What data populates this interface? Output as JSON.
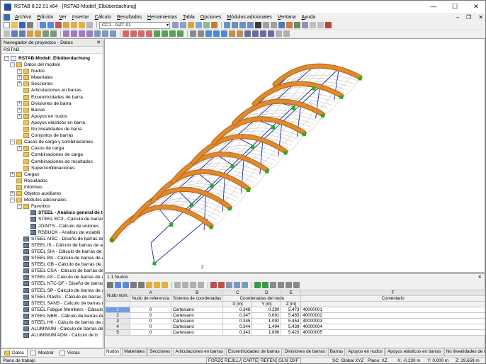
{
  "window": {
    "title": "RSTAB 8.22.01 x64 - [RSTAB-Modell_Elbüberdachung]",
    "minimize": "—",
    "maximize": "☐",
    "close": "✕"
  },
  "menu": {
    "items": [
      "Archivo",
      "Edición",
      "Ver",
      "Insertar",
      "Cálculo",
      "Resultados",
      "Herramientas",
      "Tabla",
      "Opciones",
      "Módulos adicionales",
      "Ventana",
      "Ayuda"
    ]
  },
  "toolbar": {
    "load_case_combo": "CC1 - GZT 01"
  },
  "navigator": {
    "title": "Navegador de proyectos - Datos",
    "root": "RSTAB",
    "model": "RSTAB-Modell_Elbüberdachung",
    "items": [
      {
        "label": "Datos del modelo",
        "level": 1,
        "icon": "folder"
      },
      {
        "label": "Nudos",
        "level": 2,
        "icon": "folder"
      },
      {
        "label": "Materiales",
        "level": 2,
        "icon": "folder"
      },
      {
        "label": "Secciones",
        "level": 2,
        "icon": "folder"
      },
      {
        "label": "Articulaciones en barras",
        "level": 2,
        "icon": "folder"
      },
      {
        "label": "Excentricidades de barra",
        "level": 2,
        "icon": "folder"
      },
      {
        "label": "Divisiones de barra",
        "level": 2,
        "icon": "folder"
      },
      {
        "label": "Barras",
        "level": 2,
        "icon": "folder"
      },
      {
        "label": "Apoyos en nudos",
        "level": 2,
        "icon": "folder"
      },
      {
        "label": "Apoyos elásticos en barra",
        "level": 2,
        "icon": "folder"
      },
      {
        "label": "No linealidades de barra",
        "level": 2,
        "icon": "folder"
      },
      {
        "label": "Conjuntos de barras",
        "level": 2,
        "icon": "folder"
      },
      {
        "label": "Casos de carga y combinaciones",
        "level": 1,
        "icon": "folder"
      },
      {
        "label": "Casos de carga",
        "level": 2,
        "icon": "folder"
      },
      {
        "label": "Combinaciones de carga",
        "level": 2,
        "icon": "folder"
      },
      {
        "label": "Combinaciones de resultados",
        "level": 2,
        "icon": "folder"
      },
      {
        "label": "Supercombinaciones",
        "level": 2,
        "icon": "folder"
      },
      {
        "label": "Cargas",
        "level": 1,
        "icon": "folder"
      },
      {
        "label": "Resultados",
        "level": 1,
        "icon": "folder"
      },
      {
        "label": "Informes",
        "level": 1,
        "icon": "folder"
      },
      {
        "label": "Objetos auxiliares",
        "level": 1,
        "icon": "folder"
      },
      {
        "label": "Módulos adicionales",
        "level": 1,
        "icon": "folder"
      },
      {
        "label": "Favoritos",
        "level": 2,
        "icon": "folder"
      },
      {
        "label": "STEEL - Análisis general de t",
        "level": 3,
        "icon": "steel",
        "bold": true
      },
      {
        "label": "STEEL EC3 - Cálculo de barras",
        "level": 3,
        "icon": "steel"
      },
      {
        "label": "JOINTS - Cálculo de uniones",
        "level": 3,
        "icon": "steel"
      },
      {
        "label": "RSBUCK - Análisis de estabili",
        "level": 3,
        "icon": "steel"
      },
      {
        "label": "STEEL AISC - Diseño de barras de",
        "level": 2,
        "icon": "steel"
      },
      {
        "label": "STEEL IS - Cálculo de barras de ac",
        "level": 2,
        "icon": "steel"
      },
      {
        "label": "STEEL SIA - Cálculo de barras de a",
        "level": 2,
        "icon": "steel"
      },
      {
        "label": "STEEL BS - Cálculo de barras de a",
        "level": 2,
        "icon": "steel"
      },
      {
        "label": "STEEL GB - Cálculo de barras de a",
        "level": 2,
        "icon": "steel"
      },
      {
        "label": "STEEL CSA - Cálculo de barras de",
        "level": 2,
        "icon": "steel"
      },
      {
        "label": "STEEL AS - Cálculo de barras de a",
        "level": 2,
        "icon": "steel"
      },
      {
        "label": "STEEL NTC-DF - Diseño de barras",
        "level": 2,
        "icon": "steel"
      },
      {
        "label": "STEEL SP - Cálculo de barras de a",
        "level": 2,
        "icon": "steel"
      },
      {
        "label": "STEEL Plastic - Cálculo de barras",
        "level": 2,
        "icon": "steel"
      },
      {
        "label": "STEEL SANS - Cálculo de barras d",
        "level": 2,
        "icon": "steel"
      },
      {
        "label": "STEEL Fatigue Members - Cálculo",
        "level": 2,
        "icon": "steel"
      },
      {
        "label": "STEEL NBR - Cálculo de barras de",
        "level": 2,
        "icon": "steel"
      },
      {
        "label": "STEEL HK - Cálculo de barras de a",
        "level": 2,
        "icon": "steel"
      },
      {
        "label": "ALUMINUM - Cálculo de barras de",
        "level": 2,
        "icon": "steel"
      },
      {
        "label": "ALUMINUM ADM - Cálculo de b",
        "level": 2,
        "icon": "steel"
      }
    ],
    "tabs": [
      "Datos",
      "Mostrar",
      "Vistas"
    ]
  },
  "viewport": {
    "axis_label": "Z"
  },
  "table_panel": {
    "title": "1.1 Nudos",
    "col_letters": [
      "A",
      "B",
      "C",
      "D",
      "E",
      "F"
    ],
    "headers": {
      "node_no": "Nudo núm.",
      "ref": "Nudo de referencia",
      "system": "Sistema de coordenadas",
      "coords": "Coordenadas del nudo",
      "x": "X [m]",
      "y": "Y [m]",
      "z": "Z [m]",
      "comment": "Comentario"
    },
    "rows": [
      {
        "no": "1",
        "ref": "0",
        "sys": "Cartesiano",
        "x": "0.348",
        "y": "0.290",
        "z": "5.473",
        "c": "40000001"
      },
      {
        "no": "2",
        "ref": "0",
        "sys": "Cartesiano",
        "x": "0.347",
        "y": "0.691",
        "z": "5.465",
        "c": "40000002"
      },
      {
        "no": "3",
        "ref": "0",
        "sys": "Cartesiano",
        "x": "0.345",
        "y": "1.092",
        "z": "5.454",
        "c": "40000003"
      },
      {
        "no": "4",
        "ref": "0",
        "sys": "Cartesiano",
        "x": "0.344",
        "y": "1.494",
        "z": "5.439",
        "c": "40000004"
      },
      {
        "no": "5",
        "ref": "0",
        "sys": "Cartesiano",
        "x": "0.343",
        "y": "1.896",
        "z": "5.420",
        "c": "40000005"
      }
    ]
  },
  "table_tabs": [
    "Nudos",
    "Materiales",
    "Secciones",
    "Articulaciones en barras",
    "Excentricidades de barras",
    "Divisiones de barras",
    "Barras",
    "Apoyos en nudos",
    "Apoyos elásticos en barras",
    "No linealidades de barra"
  ],
  "status": {
    "left": "Plano de trabajo",
    "buttons": [
      "FORZC",
      "REJILLA",
      "CARTES",
      "REFENT",
      "GLN",
      "DXF"
    ],
    "sc": "SC: Global XYZ",
    "plano": "Plano: XZ",
    "x": "X: -0.230 m",
    "y": "Y: 0.000 m",
    "z": "Z: 29.659 m"
  },
  "colors": {
    "beam": "#e08a2b",
    "brace": "#1a2a9a",
    "support": "#1bb31b",
    "selection": "#6c9ee3"
  }
}
